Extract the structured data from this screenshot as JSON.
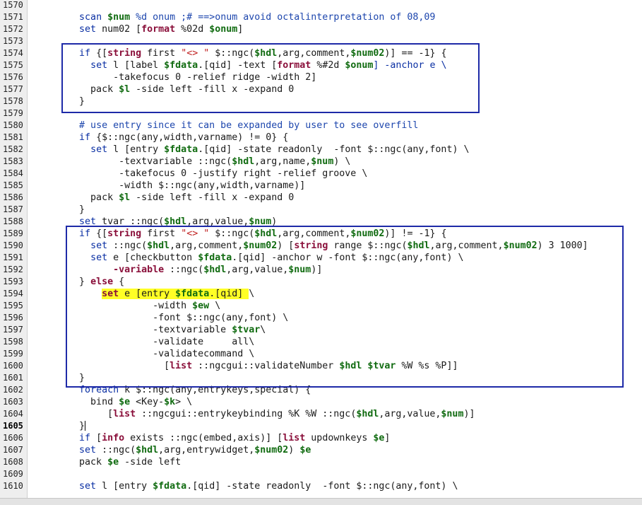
{
  "editor": {
    "current_line": "1605",
    "lines": [
      {
        "n": "1570",
        "tokens": []
      },
      {
        "n": "1571",
        "tokens": [
          {
            "t": "        ",
            "c": "plain"
          },
          {
            "t": "scan",
            "c": "keyword"
          },
          {
            "t": " ",
            "c": "plain"
          },
          {
            "t": "$num",
            "c": "var"
          },
          {
            "t": " %d onum ;# ==>onum avoid octalinterpretation of 08,09",
            "c": "comment"
          }
        ]
      },
      {
        "n": "1572",
        "tokens": [
          {
            "t": "        ",
            "c": "plain"
          },
          {
            "t": "set",
            "c": "keyword"
          },
          {
            "t": " num02 [",
            "c": "plain"
          },
          {
            "t": "format",
            "c": "cmd"
          },
          {
            "t": " %02d ",
            "c": "plain"
          },
          {
            "t": "$onum",
            "c": "var"
          },
          {
            "t": "]",
            "c": "plain"
          }
        ]
      },
      {
        "n": "1573",
        "tokens": []
      },
      {
        "n": "1574",
        "tokens": [
          {
            "t": "        ",
            "c": "plain"
          },
          {
            "t": "if",
            "c": "keyword"
          },
          {
            "t": " {[",
            "c": "plain"
          },
          {
            "t": "string",
            "c": "cmd"
          },
          {
            "t": " first ",
            "c": "plain"
          },
          {
            "t": "\"<> \"",
            "c": "string"
          },
          {
            "t": " $::ngc(",
            "c": "plain"
          },
          {
            "t": "$hdl",
            "c": "var"
          },
          {
            "t": ",arg,comment,",
            "c": "plain"
          },
          {
            "t": "$num02",
            "c": "var"
          },
          {
            "t": ")] == -1} {",
            "c": "plain"
          }
        ]
      },
      {
        "n": "1575",
        "tokens": [
          {
            "t": "          ",
            "c": "plain"
          },
          {
            "t": "set",
            "c": "keyword"
          },
          {
            "t": " l [label ",
            "c": "plain"
          },
          {
            "t": "$fdata",
            "c": "var"
          },
          {
            "t": ".[qid] -text [",
            "c": "plain"
          },
          {
            "t": "format",
            "c": "cmd"
          },
          {
            "t": " %#2d ",
            "c": "plain"
          },
          {
            "t": "$onum",
            "c": "var"
          },
          {
            "t": "] -anchor e \\",
            "c": "keyword"
          }
        ]
      },
      {
        "n": "1576",
        "tokens": [
          {
            "t": "              -takefocus 0 -relief ridge -width 2]",
            "c": "plain"
          }
        ]
      },
      {
        "n": "1577",
        "tokens": [
          {
            "t": "          pack ",
            "c": "plain"
          },
          {
            "t": "$l",
            "c": "var"
          },
          {
            "t": " -side left -fill x -expand 0",
            "c": "plain"
          }
        ]
      },
      {
        "n": "1578",
        "tokens": [
          {
            "t": "        }",
            "c": "plain"
          }
        ]
      },
      {
        "n": "1579",
        "tokens": []
      },
      {
        "n": "1580",
        "tokens": [
          {
            "t": "        ",
            "c": "plain"
          },
          {
            "t": "# use entry since it can be expanded by user to see overfill",
            "c": "comment"
          }
        ]
      },
      {
        "n": "1581",
        "tokens": [
          {
            "t": "        ",
            "c": "plain"
          },
          {
            "t": "if",
            "c": "keyword"
          },
          {
            "t": " {$::ngc(any,width,varname) != 0} {",
            "c": "plain"
          }
        ]
      },
      {
        "n": "1582",
        "tokens": [
          {
            "t": "          ",
            "c": "plain"
          },
          {
            "t": "set",
            "c": "keyword"
          },
          {
            "t": " l [entry ",
            "c": "plain"
          },
          {
            "t": "$fdata",
            "c": "var"
          },
          {
            "t": ".[qid] -state readonly  -font $::ngc(any,font) \\",
            "c": "plain"
          }
        ]
      },
      {
        "n": "1583",
        "tokens": [
          {
            "t": "               -textvariable ::ngc(",
            "c": "plain"
          },
          {
            "t": "$hdl",
            "c": "var"
          },
          {
            "t": ",arg,name,",
            "c": "plain"
          },
          {
            "t": "$num",
            "c": "var"
          },
          {
            "t": ") \\",
            "c": "plain"
          }
        ]
      },
      {
        "n": "1584",
        "tokens": [
          {
            "t": "               -takefocus 0 -justify right -relief groove \\",
            "c": "plain"
          }
        ]
      },
      {
        "n": "1585",
        "tokens": [
          {
            "t": "               -width $::ngc(any,width,varname)]",
            "c": "plain"
          }
        ]
      },
      {
        "n": "1586",
        "tokens": [
          {
            "t": "          pack ",
            "c": "plain"
          },
          {
            "t": "$l",
            "c": "var"
          },
          {
            "t": " -side left -fill x -expand 0",
            "c": "plain"
          }
        ]
      },
      {
        "n": "1587",
        "tokens": [
          {
            "t": "        }",
            "c": "plain"
          }
        ]
      },
      {
        "n": "1588",
        "tokens": [
          {
            "t": "        ",
            "c": "plain"
          },
          {
            "t": "set",
            "c": "keyword"
          },
          {
            "t": " tvar ::ngc(",
            "c": "plain"
          },
          {
            "t": "$hdl",
            "c": "var"
          },
          {
            "t": ",arg,value,",
            "c": "plain"
          },
          {
            "t": "$num",
            "c": "var"
          },
          {
            "t": ")",
            "c": "plain"
          }
        ]
      },
      {
        "n": "1589",
        "tokens": [
          {
            "t": "        ",
            "c": "plain"
          },
          {
            "t": "if",
            "c": "keyword"
          },
          {
            "t": " {[",
            "c": "plain"
          },
          {
            "t": "string",
            "c": "cmd"
          },
          {
            "t": " first ",
            "c": "plain"
          },
          {
            "t": "\"<> \"",
            "c": "string"
          },
          {
            "t": " $::ngc(",
            "c": "plain"
          },
          {
            "t": "$hdl",
            "c": "var"
          },
          {
            "t": ",arg,comment,",
            "c": "plain"
          },
          {
            "t": "$num02",
            "c": "var"
          },
          {
            "t": ")] != -1} {",
            "c": "plain"
          }
        ]
      },
      {
        "n": "1590",
        "tokens": [
          {
            "t": "          ",
            "c": "plain"
          },
          {
            "t": "set",
            "c": "keyword"
          },
          {
            "t": " ::ngc(",
            "c": "plain"
          },
          {
            "t": "$hdl",
            "c": "var"
          },
          {
            "t": ",arg,comment,",
            "c": "plain"
          },
          {
            "t": "$num02",
            "c": "var"
          },
          {
            "t": ") [",
            "c": "plain"
          },
          {
            "t": "string",
            "c": "cmd"
          },
          {
            "t": " range $::ngc(",
            "c": "plain"
          },
          {
            "t": "$hdl",
            "c": "var"
          },
          {
            "t": ",arg,comment,",
            "c": "plain"
          },
          {
            "t": "$num02",
            "c": "var"
          },
          {
            "t": ") 3 1000]",
            "c": "plain"
          }
        ]
      },
      {
        "n": "1591",
        "tokens": [
          {
            "t": "          ",
            "c": "plain"
          },
          {
            "t": "set",
            "c": "keyword"
          },
          {
            "t": " e [checkbutton ",
            "c": "plain"
          },
          {
            "t": "$fdata",
            "c": "var"
          },
          {
            "t": ".[qid] -anchor w -font $::ngc(any,font) \\",
            "c": "plain"
          }
        ]
      },
      {
        "n": "1592",
        "tokens": [
          {
            "t": "              ",
            "c": "plain"
          },
          {
            "t": "-variable",
            "c": "cmd"
          },
          {
            "t": " ::ngc(",
            "c": "plain"
          },
          {
            "t": "$hdl",
            "c": "var"
          },
          {
            "t": ",arg,value,",
            "c": "plain"
          },
          {
            "t": "$num",
            "c": "var"
          },
          {
            "t": ")]",
            "c": "plain"
          }
        ]
      },
      {
        "n": "1593",
        "tokens": [
          {
            "t": "        } ",
            "c": "plain"
          },
          {
            "t": "else",
            "c": "cmd"
          },
          {
            "t": " {",
            "c": "plain"
          }
        ]
      },
      {
        "n": "1594",
        "tokens": [
          {
            "t": "            ",
            "c": "plain"
          },
          {
            "t": "set",
            "c": "cmd",
            "hl": true
          },
          {
            "t": " e [entry ",
            "c": "plain",
            "hl": true
          },
          {
            "t": "$fdata",
            "c": "var",
            "hl": true
          },
          {
            "t": ".[qid] ",
            "c": "plain",
            "hl": true
          },
          {
            "t": "\\",
            "c": "plain"
          }
        ]
      },
      {
        "n": "1595",
        "tokens": [
          {
            "t": "                     -width ",
            "c": "plain"
          },
          {
            "t": "$ew",
            "c": "var"
          },
          {
            "t": " \\",
            "c": "plain"
          }
        ]
      },
      {
        "n": "1596",
        "tokens": [
          {
            "t": "                     -font $::ngc(any,font) \\",
            "c": "plain"
          }
        ]
      },
      {
        "n": "1597",
        "tokens": [
          {
            "t": "                     -textvariable ",
            "c": "plain"
          },
          {
            "t": "$tvar",
            "c": "var"
          },
          {
            "t": "\\",
            "c": "plain"
          }
        ]
      },
      {
        "n": "1598",
        "tokens": [
          {
            "t": "                     -validate     all\\",
            "c": "plain"
          }
        ]
      },
      {
        "n": "1599",
        "tokens": [
          {
            "t": "                     -validatecommand \\",
            "c": "plain"
          }
        ]
      },
      {
        "n": "1600",
        "tokens": [
          {
            "t": "                       [",
            "c": "plain"
          },
          {
            "t": "list",
            "c": "cmd"
          },
          {
            "t": " ::ngcgui::validateNumber ",
            "c": "plain"
          },
          {
            "t": "$hdl",
            "c": "var"
          },
          {
            "t": " ",
            "c": "plain"
          },
          {
            "t": "$tvar",
            "c": "var"
          },
          {
            "t": " %W %s %P]]",
            "c": "plain"
          }
        ]
      },
      {
        "n": "1601",
        "tokens": [
          {
            "t": "        }",
            "c": "plain"
          }
        ]
      },
      {
        "n": "1602",
        "tokens": [
          {
            "t": "        ",
            "c": "plain"
          },
          {
            "t": "foreach",
            "c": "keyword"
          },
          {
            "t": " k $::ngc(any,entrykeys,special) {",
            "c": "plain"
          }
        ]
      },
      {
        "n": "1603",
        "tokens": [
          {
            "t": "          bind ",
            "c": "plain"
          },
          {
            "t": "$e",
            "c": "var"
          },
          {
            "t": " <Key-",
            "c": "plain"
          },
          {
            "t": "$k",
            "c": "var"
          },
          {
            "t": "> \\",
            "c": "plain"
          }
        ]
      },
      {
        "n": "1604",
        "tokens": [
          {
            "t": "             [",
            "c": "plain"
          },
          {
            "t": "list",
            "c": "cmd"
          },
          {
            "t": " ::ngcgui::entrykeybinding %K %W ::ngc(",
            "c": "plain"
          },
          {
            "t": "$hdl",
            "c": "var"
          },
          {
            "t": ",arg,value,",
            "c": "plain"
          },
          {
            "t": "$num",
            "c": "var"
          },
          {
            "t": ")]",
            "c": "plain"
          }
        ]
      },
      {
        "n": "1605",
        "caret": true,
        "tokens": [
          {
            "t": "        }",
            "c": "plain"
          }
        ]
      },
      {
        "n": "1606",
        "tokens": [
          {
            "t": "        ",
            "c": "plain"
          },
          {
            "t": "if",
            "c": "keyword"
          },
          {
            "t": " [",
            "c": "plain"
          },
          {
            "t": "info",
            "c": "cmd"
          },
          {
            "t": " exists ::ngc(embed,axis)] [",
            "c": "plain"
          },
          {
            "t": "list",
            "c": "cmd"
          },
          {
            "t": " updownkeys ",
            "c": "plain"
          },
          {
            "t": "$e",
            "c": "var"
          },
          {
            "t": "]",
            "c": "plain"
          }
        ]
      },
      {
        "n": "1607",
        "tokens": [
          {
            "t": "        ",
            "c": "plain"
          },
          {
            "t": "set",
            "c": "keyword"
          },
          {
            "t": " ::ngc(",
            "c": "plain"
          },
          {
            "t": "$hdl",
            "c": "var"
          },
          {
            "t": ",arg,entrywidget,",
            "c": "plain"
          },
          {
            "t": "$num02",
            "c": "var"
          },
          {
            "t": ") ",
            "c": "plain"
          },
          {
            "t": "$e",
            "c": "var"
          }
        ]
      },
      {
        "n": "1608",
        "tokens": [
          {
            "t": "        pack ",
            "c": "plain"
          },
          {
            "t": "$e",
            "c": "var"
          },
          {
            "t": " -side left",
            "c": "plain"
          }
        ]
      },
      {
        "n": "1609",
        "tokens": []
      },
      {
        "n": "1610",
        "tokens": [
          {
            "t": "        ",
            "c": "plain"
          },
          {
            "t": "set",
            "c": "keyword"
          },
          {
            "t": " l [entry ",
            "c": "plain"
          },
          {
            "t": "$fdata",
            "c": "var"
          },
          {
            "t": ".[qid] -state readonly  -font $::ngc(any,font) \\",
            "c": "plain"
          }
        ]
      }
    ]
  },
  "colors": {
    "keyword": "#0a2fa3",
    "var": "#106b10",
    "cmd": "#8a0f3a",
    "string": "#c02020",
    "comment": "#1d46ad",
    "highlight": "#ffff26",
    "annotation_box": "#1e2aa8",
    "gutter": "#eeeeee"
  }
}
